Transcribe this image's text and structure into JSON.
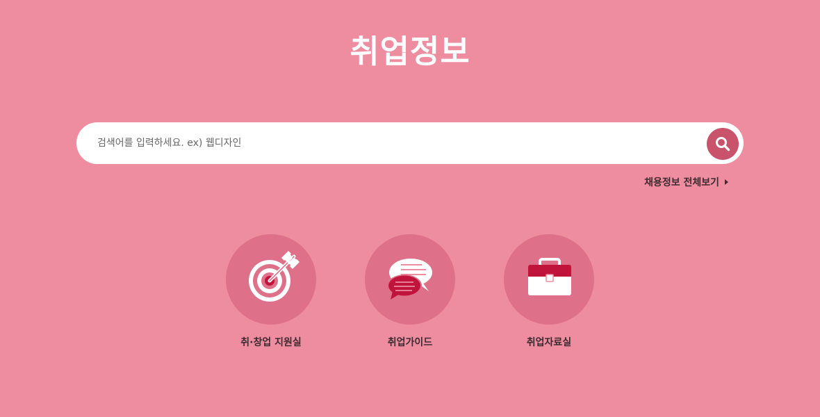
{
  "header": {
    "title": "취업정보"
  },
  "search": {
    "placeholder": "검색어를 입력하세요. ex) 웹디자인",
    "button_icon": "search-icon"
  },
  "links": {
    "view_all": "채용정보 전체보기"
  },
  "menu": {
    "items": [
      {
        "label": "취·창업 지원실",
        "icon": "target-icon"
      },
      {
        "label": "취업가이드",
        "icon": "chat-bubbles-icon"
      },
      {
        "label": "취업자료실",
        "icon": "briefcase-icon"
      }
    ]
  },
  "colors": {
    "background": "#ee8da0",
    "circle": "#de7189",
    "accent": "#c0143c",
    "search_button": "#c9536b",
    "text_dark": "#3e2a30"
  }
}
